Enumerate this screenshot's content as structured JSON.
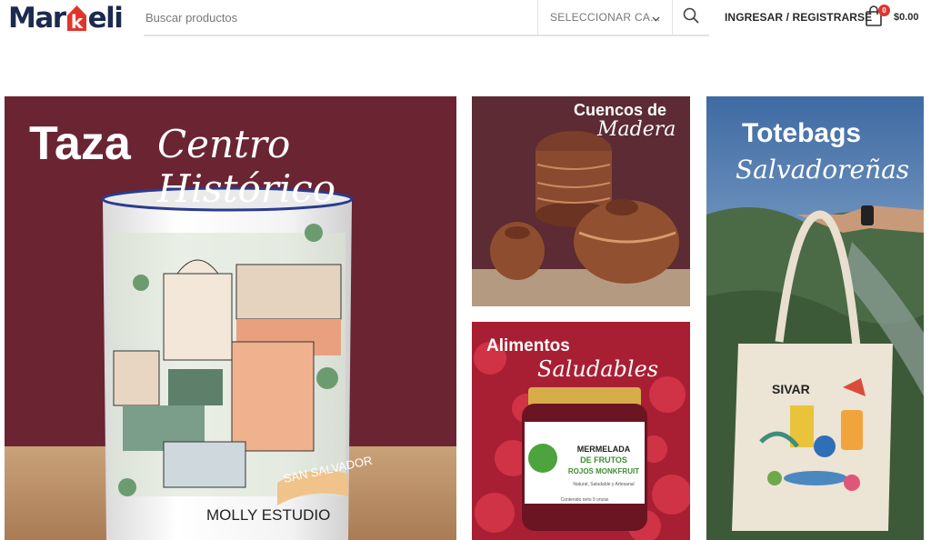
{
  "header": {
    "logo": {
      "part1": "Mar",
      "part2": "k",
      "part3": "eli"
    },
    "search": {
      "placeholder": "Buscar productos",
      "category_label": "SELECCIONAR CA..."
    },
    "login_label": "INGRESAR / REGISTRARSE",
    "cart": {
      "count": "0",
      "total": "$0.00"
    }
  },
  "banners": {
    "taza": {
      "title_bold": "Taza",
      "title_script": "Centro Histórico",
      "mug_text_1": "SAN SALVADOR",
      "mug_text_2": "MOLLY ESTUDIO"
    },
    "cuencos": {
      "title_line1": "Cuencos de",
      "title_line2": "Madera"
    },
    "alimentos": {
      "title_bold": "Alimentos",
      "title_script": "Saludables",
      "jar_label_1": "MERMELADA",
      "jar_label_2": "DE FRUTOS",
      "jar_label_3": "ROJOS MONKFRUIT",
      "jar_small": "Natural, Saludable y Artesanal",
      "jar_bottom": "Contenido neto 9 onzas"
    },
    "totebags": {
      "title_bold": "Totebags",
      "title_script": "Salvadoreñas",
      "bag_text": "SIVAR"
    }
  },
  "colors": {
    "brand_navy": "#1b2a4e",
    "brand_red": "#e0352b",
    "taza_bg": "#6a2432",
    "tote_sky": "#4f76a5"
  }
}
